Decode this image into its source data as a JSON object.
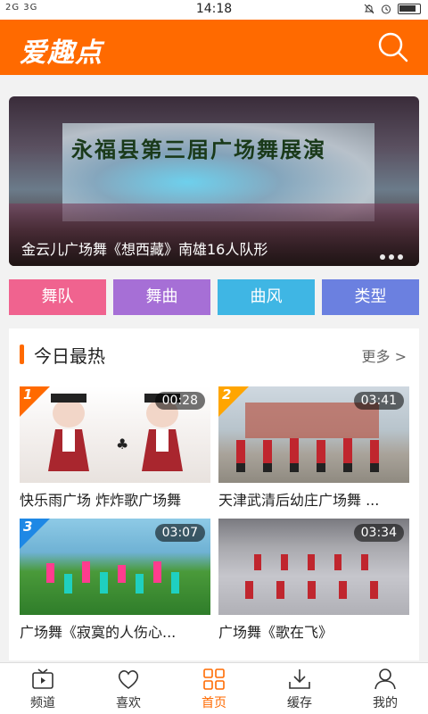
{
  "status_bar": {
    "signal_left": "2G 3G",
    "time": "14:18"
  },
  "app": {
    "logo": "爱趣点",
    "brand_color": "#ff6a00"
  },
  "banner": {
    "stage_text": "永福县第三届广场舞展演",
    "caption": "金云儿广场舞《想西藏》南雄16人队形"
  },
  "categories": [
    {
      "label": "舞队",
      "color": "#f0638f"
    },
    {
      "label": "舞曲",
      "color": "#a66fd6"
    },
    {
      "label": "曲风",
      "color": "#3fb6e4"
    },
    {
      "label": "类型",
      "color": "#6b80e0"
    }
  ],
  "hot": {
    "title": "今日最热",
    "more_label": "更多 >",
    "videos": [
      {
        "rank": "1",
        "duration": "00:28",
        "title": "快乐雨广场 炸炸歌广场舞",
        "rank_color": "#ff6a00"
      },
      {
        "rank": "2",
        "duration": "03:41",
        "title": "天津武清后幼庄广场舞 ...",
        "rank_color": "#ffa500"
      },
      {
        "rank": "3",
        "duration": "03:07",
        "title": "广场舞《寂寞的人伤心...",
        "rank_color": "#1e88e5"
      },
      {
        "rank": "",
        "duration": "03:34",
        "title": "广场舞《歌在飞》",
        "rank_color": ""
      }
    ]
  },
  "tabs": [
    {
      "label": "频道",
      "icon": "channel-icon"
    },
    {
      "label": "喜欢",
      "icon": "heart-icon"
    },
    {
      "label": "首页",
      "icon": "home-grid-icon"
    },
    {
      "label": "缓存",
      "icon": "download-icon"
    },
    {
      "label": "我的",
      "icon": "user-icon"
    }
  ],
  "active_tab": "首页"
}
